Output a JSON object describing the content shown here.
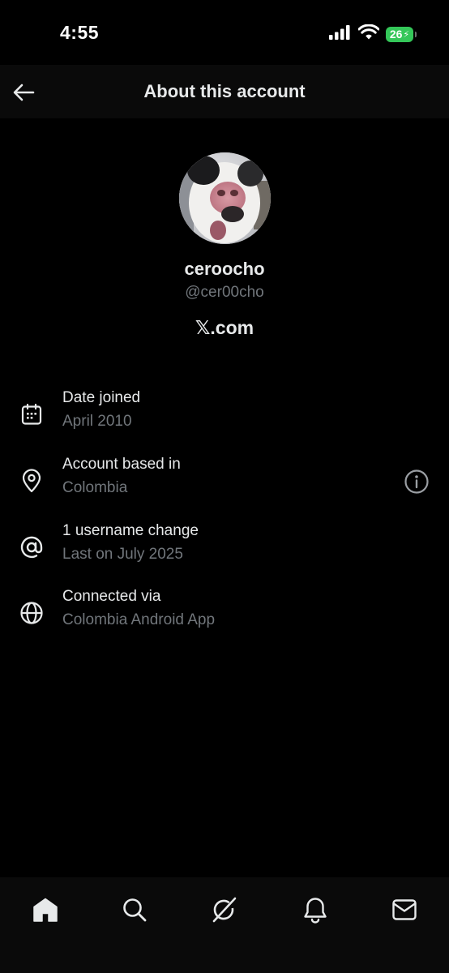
{
  "status_bar": {
    "time": "4:55",
    "battery_level": "26",
    "icons": [
      "cellular-signal-icon",
      "wifi-icon",
      "battery-charging-icon"
    ]
  },
  "header": {
    "title": "About this account",
    "back_icon": "arrow-left-icon"
  },
  "profile": {
    "display_name": "ceroocho",
    "handle": "@cer00cho",
    "source_site": "𝕏.com"
  },
  "details": [
    {
      "icon": "calendar-icon",
      "title": "Date joined",
      "value": "April 2010"
    },
    {
      "icon": "location-pin-icon",
      "title": "Account based in",
      "value": "Colombia",
      "has_info": true
    },
    {
      "icon": "at-sign-icon",
      "title": "1 username change",
      "value": "Last on July 2025"
    },
    {
      "icon": "globe-icon",
      "title": "Connected via",
      "value": "Colombia Android App"
    }
  ],
  "bottom_nav": [
    "home-icon",
    "search-icon",
    "grok-icon",
    "notifications-bell-icon",
    "messages-envelope-icon"
  ],
  "colors": {
    "background": "#000000",
    "header_background": "#0a0a0a",
    "primary_text": "#e7e9ea",
    "secondary_text": "#71767b",
    "battery_green": "#34c759"
  }
}
